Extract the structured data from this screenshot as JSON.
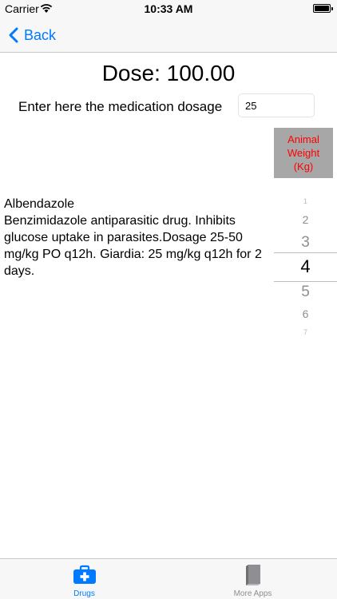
{
  "status": {
    "carrier": "Carrier",
    "time": "10:33 AM",
    "battery_level": 1.0
  },
  "nav": {
    "back_label": "Back"
  },
  "dose": {
    "title": "Dose: 100.00"
  },
  "dosage": {
    "label": "Enter here the medication dosage",
    "value": "25"
  },
  "weight_button": {
    "lines": [
      "Animal",
      "Weight",
      "(Kg)"
    ]
  },
  "drug": {
    "name": "Albendazole",
    "description": "Benzimidazole antiparasitic drug. Inhibits glucose uptake in parasites.Dosage 25-50 mg/kg PO q12h. Giardia: 25 mg/kg q12h for 2 days."
  },
  "picker": {
    "items": [
      "1",
      "2",
      "3",
      "4",
      "5",
      "6",
      "7"
    ],
    "selected": "4"
  },
  "tabs": [
    {
      "label": "Drugs",
      "icon": "medical-kit-icon",
      "active": true
    },
    {
      "label": "More Apps",
      "icon": "book-icon",
      "active": false
    }
  ],
  "colors": {
    "accent": "#007aff",
    "weight_text": "#ff0000",
    "weight_bg": "#a7a7a7",
    "inactive": "#8e8e93"
  }
}
